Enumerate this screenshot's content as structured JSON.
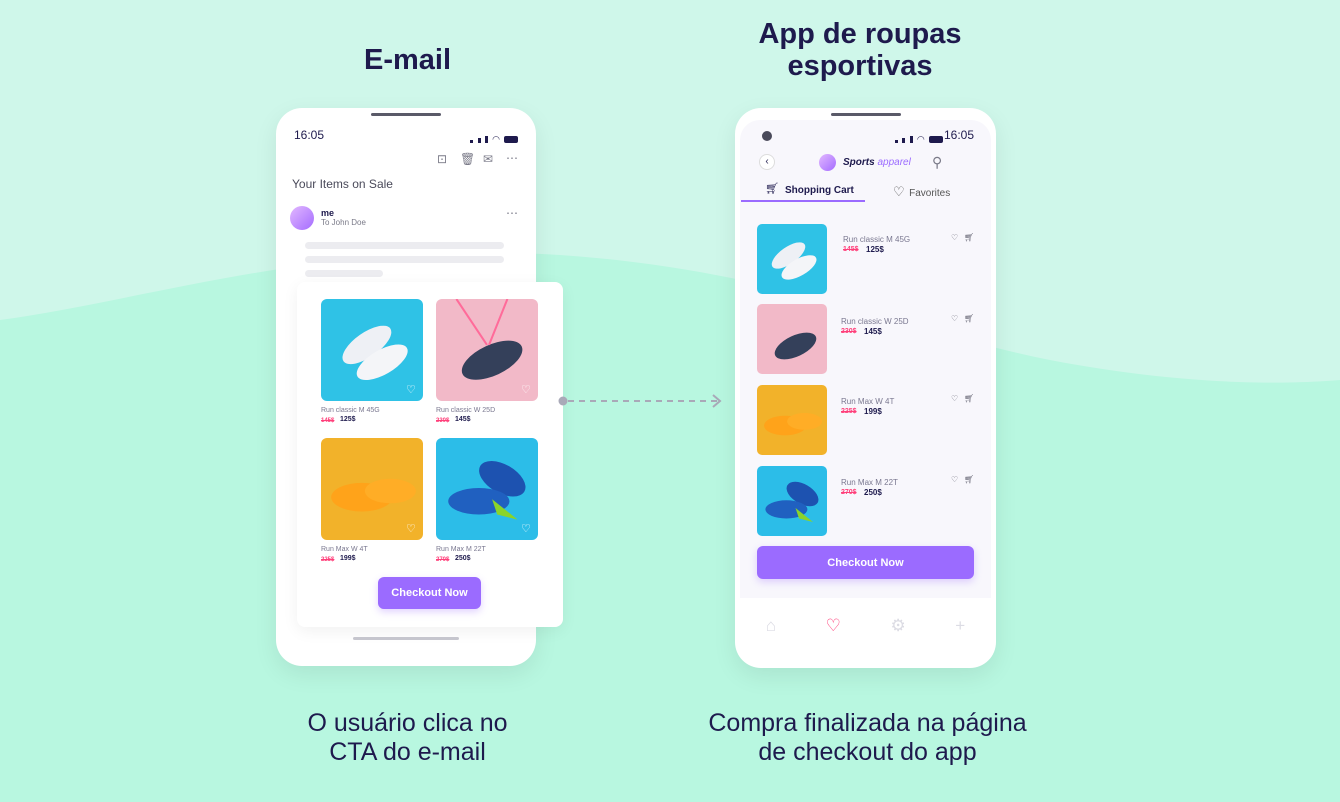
{
  "headings": {
    "email": "E-mail",
    "app_line1": "App de roupas",
    "app_line2": "esportivas"
  },
  "captions": {
    "email_line1": "O usuário clica no",
    "email_line2": "CTA do e-mail",
    "app_line1": "Compra finalizada na página",
    "app_line2": "de checkout do app"
  },
  "colors": {
    "accent": "#9b6bff",
    "sale": "#ff3f7a",
    "text": "#1e1a4d",
    "background": "#cff7ea"
  },
  "email_phone": {
    "time": "16:05",
    "toolbar_icons": [
      "archive-icon",
      "trash-icon",
      "mail-icon",
      "more-icon"
    ],
    "subject": "Your Items on Sale",
    "sender": "me",
    "recipient": "To John Doe",
    "products": [
      {
        "name": "Run classic M 45G",
        "old_price": "145$",
        "price": "125$"
      },
      {
        "name": "Run classic W 25D",
        "old_price": "230$",
        "price": "145$"
      },
      {
        "name": "Run Max W 4T",
        "old_price": "225$",
        "price": "199$"
      },
      {
        "name": "Run Max M 22T",
        "old_price": "270$",
        "price": "250$"
      }
    ],
    "cta": "Checkout Now"
  },
  "app_phone": {
    "time": "16:05",
    "brand_bold": "Sports",
    "brand_light": "apparel",
    "tabs": [
      {
        "label": "Shopping Cart",
        "active": true
      },
      {
        "label": "Favorites",
        "active": false
      }
    ],
    "items": [
      {
        "name": "Run classic M 45G",
        "old_price": "145$",
        "price": "125$"
      },
      {
        "name": "Run classic W 25D",
        "old_price": "230$",
        "price": "145$"
      },
      {
        "name": "Run Max W 4T",
        "old_price": "225$",
        "price": "199$"
      },
      {
        "name": "Run Max M 22T",
        "old_price": "270$",
        "price": "250$"
      }
    ],
    "cta": "Checkout Now",
    "nav": [
      "home-icon",
      "heart-icon",
      "gear-icon",
      "plus-icon"
    ],
    "nav_active": "heart-icon"
  }
}
